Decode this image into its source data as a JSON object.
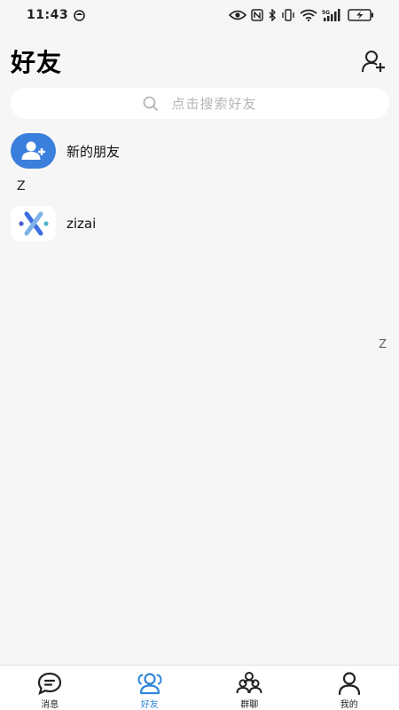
{
  "status_bar": {
    "time": "11:43",
    "network_label": "5G"
  },
  "header": {
    "title": "好友"
  },
  "search": {
    "placeholder": "点击搜索好友"
  },
  "new_friends": {
    "label": "新的朋友"
  },
  "sections": [
    {
      "letter": "Z",
      "contacts": [
        {
          "name": "zizai"
        }
      ]
    }
  ],
  "index_bar": {
    "letters": [
      "Z"
    ]
  },
  "tabs": [
    {
      "label": "消息",
      "icon": "message-icon",
      "active": false
    },
    {
      "label": "好友",
      "icon": "friends-icon",
      "active": true
    },
    {
      "label": "群聊",
      "icon": "group-chat-icon",
      "active": false
    },
    {
      "label": "我的",
      "icon": "profile-icon",
      "active": false
    }
  ],
  "colors": {
    "accent": "#3a7fdc",
    "active_tab": "#2f86d8",
    "background": "#f6f6f6"
  }
}
